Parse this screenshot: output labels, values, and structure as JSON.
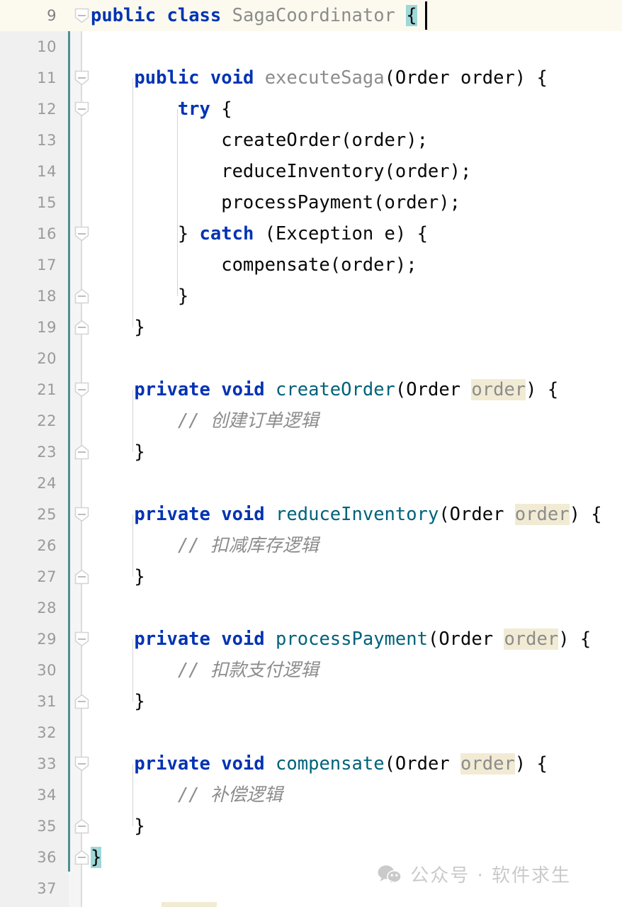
{
  "editor": {
    "language": "java",
    "colors": {
      "keyword": "#0033B3",
      "method": "#00627A",
      "muted_identifier": "#8C8C8C",
      "plain_text": "#080808",
      "comment": "#8C8C8C",
      "identifier_highlight_bg": "#F2EBD4",
      "brace_match_bg": "#9FD8D8",
      "current_line_bg": "#FCFAEF",
      "gutter_bg": "#F0F0F0",
      "line_number": "#9A9A9A",
      "scope_bar": "#4C8F92",
      "indent_guide": "#D4D4D4",
      "caret": "#000000",
      "watermark": "#C9C9C9"
    },
    "caret": {
      "line": 9,
      "column": 29
    },
    "lines": [
      {
        "number": "9",
        "current": true,
        "fold": "collapse-start",
        "indent": 0,
        "tokens": [
          {
            "text": "public",
            "style": "kw"
          },
          {
            "text": " ",
            "style": "plain"
          },
          {
            "text": "class",
            "style": "kw"
          },
          {
            "text": " ",
            "style": "plain"
          },
          {
            "text": "SagaCoordinator",
            "style": "gry"
          },
          {
            "text": " ",
            "style": "plain"
          },
          {
            "text": "{",
            "style": "brace-hl"
          }
        ]
      },
      {
        "number": "10",
        "current": false,
        "fold": "none",
        "indent": 0,
        "tokens": []
      },
      {
        "number": "11",
        "current": false,
        "fold": "collapse-start",
        "indent": 1,
        "tokens": [
          {
            "text": "    ",
            "style": "plain"
          },
          {
            "text": "public",
            "style": "kw"
          },
          {
            "text": " ",
            "style": "plain"
          },
          {
            "text": "void",
            "style": "kw"
          },
          {
            "text": " ",
            "style": "plain"
          },
          {
            "text": "executeSaga",
            "style": "gry"
          },
          {
            "text": "(Order order) {",
            "style": "plain"
          }
        ]
      },
      {
        "number": "12",
        "current": false,
        "fold": "collapse-start",
        "indent": 2,
        "tokens": [
          {
            "text": "        ",
            "style": "plain"
          },
          {
            "text": "try",
            "style": "kw"
          },
          {
            "text": " {",
            "style": "plain"
          }
        ]
      },
      {
        "number": "13",
        "current": false,
        "fold": "none",
        "indent": 3,
        "tokens": [
          {
            "text": "            createOrder(order);",
            "style": "plain"
          }
        ]
      },
      {
        "number": "14",
        "current": false,
        "fold": "none",
        "indent": 3,
        "tokens": [
          {
            "text": "            reduceInventory(order);",
            "style": "plain"
          }
        ]
      },
      {
        "number": "15",
        "current": false,
        "fold": "none",
        "indent": 3,
        "tokens": [
          {
            "text": "            processPayment(order);",
            "style": "plain"
          }
        ]
      },
      {
        "number": "16",
        "current": false,
        "fold": "collapse-start",
        "indent": 2,
        "tokens": [
          {
            "text": "        } ",
            "style": "plain"
          },
          {
            "text": "catch",
            "style": "kw"
          },
          {
            "text": " (Exception e) {",
            "style": "plain"
          }
        ]
      },
      {
        "number": "17",
        "current": false,
        "fold": "none",
        "indent": 3,
        "tokens": [
          {
            "text": "            compensate(order);",
            "style": "plain"
          }
        ]
      },
      {
        "number": "18",
        "current": false,
        "fold": "collapse-end",
        "indent": 2,
        "tokens": [
          {
            "text": "        }",
            "style": "plain"
          }
        ]
      },
      {
        "number": "19",
        "current": false,
        "fold": "collapse-end",
        "indent": 1,
        "tokens": [
          {
            "text": "    }",
            "style": "plain"
          }
        ]
      },
      {
        "number": "20",
        "current": false,
        "fold": "none",
        "indent": 0,
        "tokens": []
      },
      {
        "number": "21",
        "current": false,
        "fold": "collapse-start",
        "indent": 1,
        "tokens": [
          {
            "text": "    ",
            "style": "plain"
          },
          {
            "text": "private",
            "style": "kw"
          },
          {
            "text": " ",
            "style": "plain"
          },
          {
            "text": "void",
            "style": "kw"
          },
          {
            "text": " ",
            "style": "plain"
          },
          {
            "text": "createOrder",
            "style": "mth"
          },
          {
            "text": "(Order ",
            "style": "plain"
          },
          {
            "text": "order",
            "style": "ident-hl"
          },
          {
            "text": ") {",
            "style": "plain"
          }
        ]
      },
      {
        "number": "22",
        "current": false,
        "fold": "none",
        "indent": 2,
        "tokens": [
          {
            "text": "        // 创建订单逻辑",
            "style": "cmt"
          }
        ]
      },
      {
        "number": "23",
        "current": false,
        "fold": "collapse-end",
        "indent": 1,
        "tokens": [
          {
            "text": "    }",
            "style": "plain"
          }
        ]
      },
      {
        "number": "24",
        "current": false,
        "fold": "none",
        "indent": 0,
        "tokens": []
      },
      {
        "number": "25",
        "current": false,
        "fold": "collapse-start",
        "indent": 1,
        "tokens": [
          {
            "text": "    ",
            "style": "plain"
          },
          {
            "text": "private",
            "style": "kw"
          },
          {
            "text": " ",
            "style": "plain"
          },
          {
            "text": "void",
            "style": "kw"
          },
          {
            "text": " ",
            "style": "plain"
          },
          {
            "text": "reduceInventory",
            "style": "mth"
          },
          {
            "text": "(Order ",
            "style": "plain"
          },
          {
            "text": "order",
            "style": "ident-hl"
          },
          {
            "text": ") {",
            "style": "plain"
          }
        ]
      },
      {
        "number": "26",
        "current": false,
        "fold": "none",
        "indent": 2,
        "tokens": [
          {
            "text": "        // 扣减库存逻辑",
            "style": "cmt"
          }
        ]
      },
      {
        "number": "27",
        "current": false,
        "fold": "collapse-end",
        "indent": 1,
        "tokens": [
          {
            "text": "    }",
            "style": "plain"
          }
        ]
      },
      {
        "number": "28",
        "current": false,
        "fold": "none",
        "indent": 0,
        "tokens": []
      },
      {
        "number": "29",
        "current": false,
        "fold": "collapse-start",
        "indent": 1,
        "tokens": [
          {
            "text": "    ",
            "style": "plain"
          },
          {
            "text": "private",
            "style": "kw"
          },
          {
            "text": " ",
            "style": "plain"
          },
          {
            "text": "void",
            "style": "kw"
          },
          {
            "text": " ",
            "style": "plain"
          },
          {
            "text": "processPayment",
            "style": "mth"
          },
          {
            "text": "(Order ",
            "style": "plain"
          },
          {
            "text": "order",
            "style": "ident-hl"
          },
          {
            "text": ") {",
            "style": "plain"
          }
        ]
      },
      {
        "number": "30",
        "current": false,
        "fold": "none",
        "indent": 2,
        "tokens": [
          {
            "text": "        // 扣款支付逻辑",
            "style": "cmt"
          }
        ]
      },
      {
        "number": "31",
        "current": false,
        "fold": "collapse-end",
        "indent": 1,
        "tokens": [
          {
            "text": "    }",
            "style": "plain"
          }
        ]
      },
      {
        "number": "32",
        "current": false,
        "fold": "none",
        "indent": 0,
        "tokens": []
      },
      {
        "number": "33",
        "current": false,
        "fold": "collapse-start",
        "indent": 1,
        "tokens": [
          {
            "text": "    ",
            "style": "plain"
          },
          {
            "text": "private",
            "style": "kw"
          },
          {
            "text": " ",
            "style": "plain"
          },
          {
            "text": "void",
            "style": "kw"
          },
          {
            "text": " ",
            "style": "plain"
          },
          {
            "text": "compensate",
            "style": "mth"
          },
          {
            "text": "(Order ",
            "style": "plain"
          },
          {
            "text": "order",
            "style": "ident-hl"
          },
          {
            "text": ") {",
            "style": "plain"
          }
        ]
      },
      {
        "number": "34",
        "current": false,
        "fold": "none",
        "indent": 2,
        "tokens": [
          {
            "text": "        // 补偿逻辑",
            "style": "cmt"
          }
        ]
      },
      {
        "number": "35",
        "current": false,
        "fold": "collapse-end",
        "indent": 1,
        "tokens": [
          {
            "text": "    }",
            "style": "plain"
          }
        ]
      },
      {
        "number": "36",
        "current": false,
        "fold": "collapse-end",
        "indent": 0,
        "tokens": [
          {
            "text": "}",
            "style": "brace-hl"
          }
        ]
      },
      {
        "number": "37",
        "current": false,
        "fold": "none",
        "indent": 0,
        "tokens": []
      }
    ]
  },
  "watermark": {
    "icon": "wechat-icon",
    "text": "公众号 · 软件求生"
  }
}
